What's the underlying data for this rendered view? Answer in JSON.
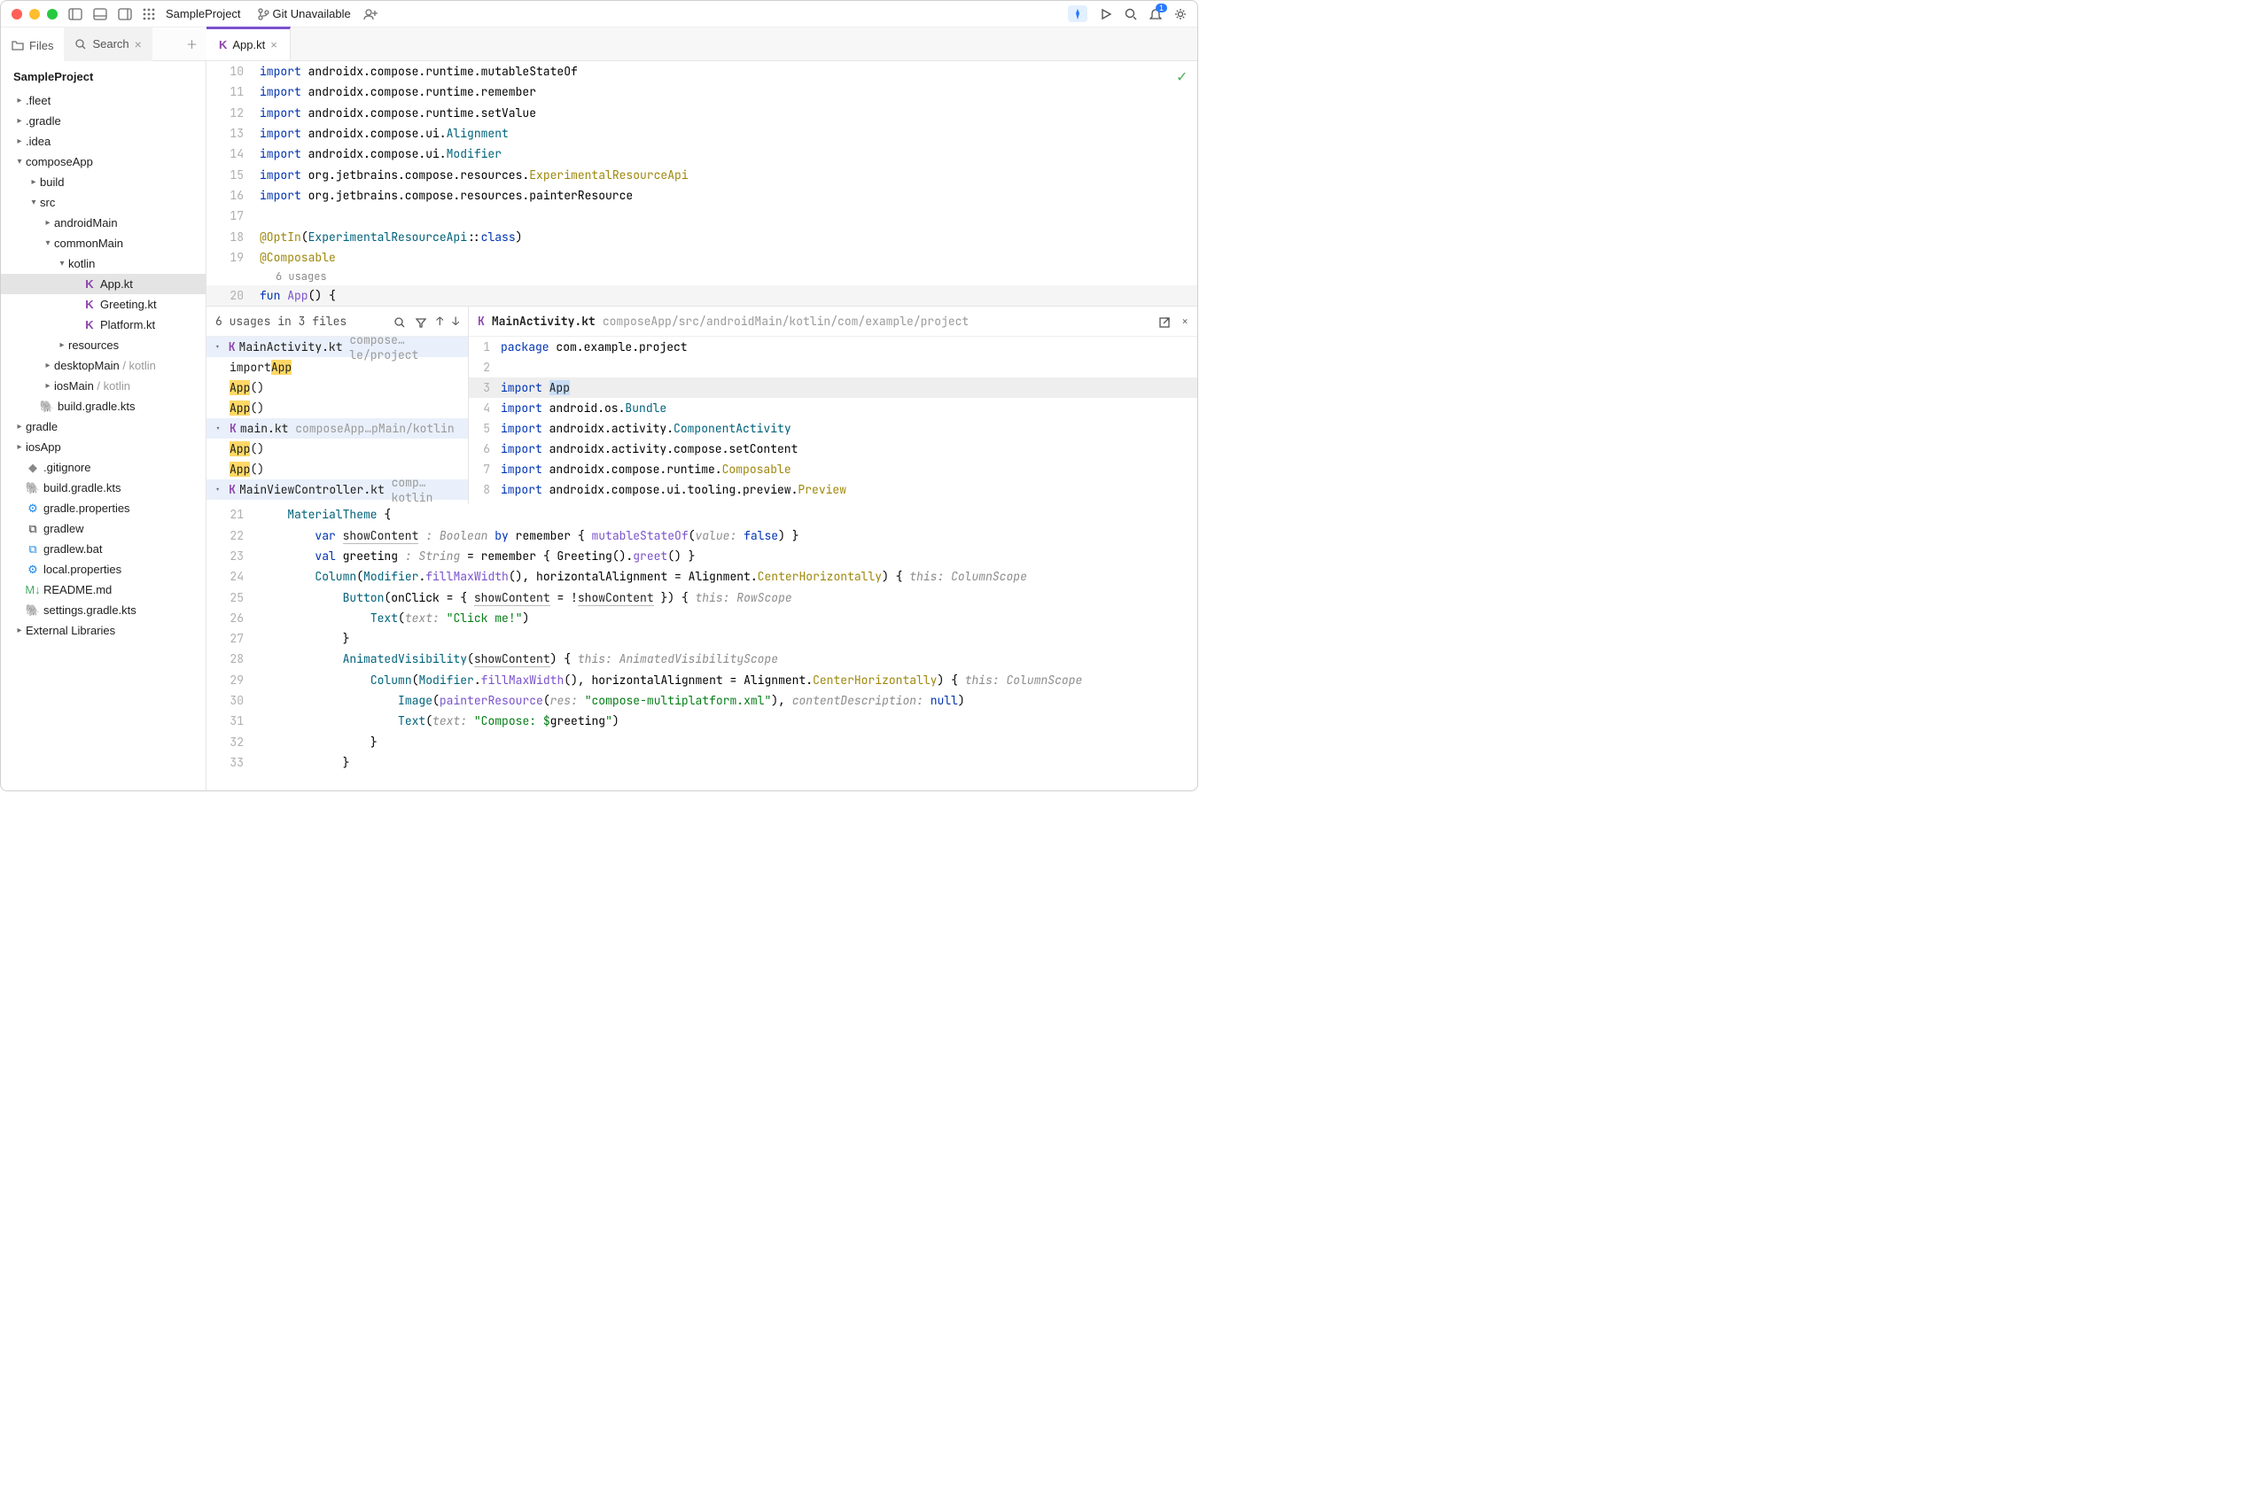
{
  "titlebar": {
    "project": "SampleProject",
    "git": "Git Unavailable",
    "notif_count": "1"
  },
  "side_tabs": {
    "files": "Files",
    "search": "Search"
  },
  "editor_tab": {
    "name": "App.kt"
  },
  "project": {
    "name": "SampleProject",
    "tree": [
      {
        "d": 0,
        "exp": "▸",
        "label": ".fleet"
      },
      {
        "d": 0,
        "exp": "▸",
        "label": ".gradle"
      },
      {
        "d": 0,
        "exp": "▸",
        "label": ".idea"
      },
      {
        "d": 0,
        "exp": "▾",
        "label": "composeApp"
      },
      {
        "d": 1,
        "exp": "▸",
        "label": "build"
      },
      {
        "d": 1,
        "exp": "▾",
        "label": "src"
      },
      {
        "d": 2,
        "exp": "▸",
        "label": "androidMain"
      },
      {
        "d": 2,
        "exp": "▾",
        "label": "commonMain"
      },
      {
        "d": 3,
        "exp": "▾",
        "label": "kotlin"
      },
      {
        "d": 4,
        "icon": "k",
        "label": "App.kt",
        "sel": true
      },
      {
        "d": 4,
        "icon": "k",
        "label": "Greeting.kt"
      },
      {
        "d": 4,
        "icon": "k",
        "label": "Platform.kt"
      },
      {
        "d": 3,
        "exp": "▸",
        "label": "resources"
      },
      {
        "d": 2,
        "exp": "▸",
        "label": "desktopMain",
        "suffix": "/ kotlin"
      },
      {
        "d": 2,
        "exp": "▸",
        "label": "iosMain",
        "suffix": "/ kotlin"
      },
      {
        "d": 1,
        "icon": "gradle",
        "label": "build.gradle.kts"
      },
      {
        "d": 0,
        "exp": "▸",
        "label": "gradle"
      },
      {
        "d": 0,
        "exp": "▸",
        "label": "iosApp"
      },
      {
        "d": 0,
        "icon": "git",
        "label": ".gitignore"
      },
      {
        "d": 0,
        "icon": "gradle",
        "label": "build.gradle.kts"
      },
      {
        "d": 0,
        "icon": "gear",
        "label": "gradle.properties"
      },
      {
        "d": 0,
        "icon": "sh",
        "label": "gradlew"
      },
      {
        "d": 0,
        "icon": "bat",
        "label": "gradlew.bat"
      },
      {
        "d": 0,
        "icon": "gear",
        "label": "local.properties"
      },
      {
        "d": 0,
        "icon": "md",
        "label": "README.md"
      },
      {
        "d": 0,
        "icon": "gradle",
        "label": "settings.gradle.kts"
      },
      {
        "d": 0,
        "exp": "▸",
        "label": "External Libraries"
      }
    ]
  },
  "editor_top": {
    "lines": [
      {
        "n": 10,
        "tokens": [
          [
            "kw",
            "import "
          ],
          [
            "id",
            "androidx.compose.runtime.mutableStateOf"
          ]
        ]
      },
      {
        "n": 11,
        "tokens": [
          [
            "kw",
            "import "
          ],
          [
            "id",
            "androidx.compose.runtime.remember"
          ]
        ]
      },
      {
        "n": 12,
        "tokens": [
          [
            "kw",
            "import "
          ],
          [
            "id",
            "androidx.compose.runtime.setValue"
          ]
        ]
      },
      {
        "n": 13,
        "tokens": [
          [
            "kw",
            "import "
          ],
          [
            "id",
            "androidx.compose.ui."
          ],
          [
            "type",
            "Alignment"
          ]
        ]
      },
      {
        "n": 14,
        "tokens": [
          [
            "kw",
            "import "
          ],
          [
            "id",
            "androidx.compose.ui."
          ],
          [
            "type",
            "Modifier"
          ]
        ]
      },
      {
        "n": 15,
        "tokens": [
          [
            "kw",
            "import "
          ],
          [
            "id",
            "org.jetbrains.compose.resources."
          ],
          [
            "ann",
            "ExperimentalResourceApi"
          ]
        ]
      },
      {
        "n": 16,
        "tokens": [
          [
            "kw",
            "import "
          ],
          [
            "id",
            "org.jetbrains.compose.resources.painterResource"
          ]
        ]
      },
      {
        "n": 17,
        "tokens": []
      },
      {
        "n": 18,
        "tokens": [
          [
            "ann",
            "@OptIn"
          ],
          [
            "id",
            "("
          ],
          [
            "type",
            "ExperimentalResourceApi"
          ],
          [
            "id",
            "::"
          ],
          [
            "kw",
            "class"
          ],
          [
            "id",
            ")"
          ]
        ]
      },
      {
        "n": 19,
        "tokens": [
          [
            "ann",
            "@Composable"
          ]
        ]
      }
    ],
    "usages_inline": "6 usages",
    "fun_line": {
      "n": 20,
      "tokens": [
        [
          "kw",
          "fun "
        ],
        [
          "fn",
          "App"
        ],
        [
          "id",
          "() {"
        ]
      ]
    }
  },
  "usages": {
    "header": "6 usages in 3 files",
    "groups": [
      {
        "file": "MainActivity.kt",
        "path": "compose…le/project",
        "items": [
          {
            "pre": "import ",
            "hl": "App",
            "post": ""
          },
          {
            "pre": "",
            "hl": "App",
            "post": "()"
          },
          {
            "pre": "",
            "hl": "App",
            "post": "()"
          }
        ]
      },
      {
        "file": "main.kt",
        "path": "composeApp…pMain/kotlin",
        "items": [
          {
            "pre": "",
            "hl": "App",
            "post": "()"
          },
          {
            "pre": "",
            "hl": "App",
            "post": "()"
          }
        ]
      },
      {
        "file": "MainViewController.kt",
        "path": "comp…kotlin",
        "items": []
      }
    ]
  },
  "preview": {
    "file": "MainActivity.kt",
    "path": "composeApp/src/androidMain/kotlin/com/example/project",
    "lines": [
      {
        "n": 1,
        "tokens": [
          [
            "kw",
            "package "
          ],
          [
            "id",
            "com.example.project"
          ]
        ]
      },
      {
        "n": 2,
        "tokens": []
      },
      {
        "n": 3,
        "hl": true,
        "tokens": [
          [
            "kw",
            "import "
          ],
          [
            "sel",
            "App"
          ]
        ]
      },
      {
        "n": 4,
        "tokens": [
          [
            "kw",
            "import "
          ],
          [
            "id",
            "android.os."
          ],
          [
            "type",
            "Bundle"
          ]
        ]
      },
      {
        "n": 5,
        "tokens": [
          [
            "kw",
            "import "
          ],
          [
            "id",
            "androidx.activity."
          ],
          [
            "type",
            "ComponentActivity"
          ]
        ]
      },
      {
        "n": 6,
        "tokens": [
          [
            "kw",
            "import "
          ],
          [
            "id",
            "androidx.activity.compose.setContent"
          ]
        ]
      },
      {
        "n": 7,
        "tokens": [
          [
            "kw",
            "import "
          ],
          [
            "id",
            "androidx.compose.runtime."
          ],
          [
            "ann",
            "Composable"
          ]
        ]
      },
      {
        "n": 8,
        "tokens": [
          [
            "kw",
            "import "
          ],
          [
            "id",
            "androidx.compose.ui.tooling.preview."
          ],
          [
            "ann",
            "Preview"
          ]
        ]
      }
    ]
  },
  "editor_bottom": {
    "lines": [
      {
        "n": 21,
        "ind": 1,
        "tokens": [
          [
            "type",
            "MaterialTheme"
          ],
          [
            "id",
            " {"
          ]
        ]
      },
      {
        "n": 22,
        "ind": 2,
        "tokens": [
          [
            "kw",
            "var "
          ],
          [
            "underl",
            "showContent"
          ],
          [
            "param",
            " : Boolean "
          ],
          [
            "kw",
            "by"
          ],
          [
            "id",
            " remember { "
          ],
          [
            "fn",
            "mutableStateOf"
          ],
          [
            "id",
            "("
          ],
          [
            "param",
            "value: "
          ],
          [
            "kw",
            "false"
          ],
          [
            "id",
            ") }"
          ]
        ]
      },
      {
        "n": 23,
        "ind": 2,
        "tokens": [
          [
            "kw",
            "val "
          ],
          [
            "id",
            "greeting"
          ],
          [
            "param",
            " : String "
          ],
          [
            "id",
            "= remember { Greeting()."
          ],
          [
            "fn",
            "greet"
          ],
          [
            "id",
            "() }"
          ]
        ]
      },
      {
        "n": 24,
        "ind": 2,
        "tokens": [
          [
            "type",
            "Column"
          ],
          [
            "id",
            "("
          ],
          [
            "type",
            "Modifier"
          ],
          [
            "id",
            "."
          ],
          [
            "fn",
            "fillMaxWidth"
          ],
          [
            "id",
            "(), horizontalAlignment = Alignment."
          ],
          [
            "ann",
            "CenterHorizontally"
          ],
          [
            "id",
            ") { "
          ],
          [
            "param",
            "this: ColumnScope"
          ]
        ]
      },
      {
        "n": 25,
        "ind": 3,
        "tokens": [
          [
            "type",
            "Button"
          ],
          [
            "id",
            "(onClick = { "
          ],
          [
            "underl",
            "showContent"
          ],
          [
            "id",
            " = !"
          ],
          [
            "underl",
            "showContent"
          ],
          [
            "id",
            " }) { "
          ],
          [
            "param",
            "this: RowScope"
          ]
        ]
      },
      {
        "n": 26,
        "ind": 4,
        "tokens": [
          [
            "type",
            "Text"
          ],
          [
            "id",
            "("
          ],
          [
            "param",
            "text: "
          ],
          [
            "str",
            "\"Click me!\""
          ],
          [
            "id",
            ")"
          ]
        ]
      },
      {
        "n": 27,
        "ind": 3,
        "tokens": [
          [
            "id",
            "}"
          ]
        ]
      },
      {
        "n": 28,
        "ind": 3,
        "tokens": [
          [
            "type",
            "AnimatedVisibility"
          ],
          [
            "id",
            "("
          ],
          [
            "underl",
            "showContent"
          ],
          [
            "id",
            ") { "
          ],
          [
            "param",
            "this: AnimatedVisibilityScope"
          ]
        ]
      },
      {
        "n": 29,
        "ind": 4,
        "tokens": [
          [
            "type",
            "Column"
          ],
          [
            "id",
            "("
          ],
          [
            "type",
            "Modifier"
          ],
          [
            "id",
            "."
          ],
          [
            "fn",
            "fillMaxWidth"
          ],
          [
            "id",
            "(), horizontalAlignment = Alignment."
          ],
          [
            "ann",
            "CenterHorizontally"
          ],
          [
            "id",
            ") { "
          ],
          [
            "param",
            "this: ColumnScope"
          ]
        ]
      },
      {
        "n": 30,
        "ind": 5,
        "tokens": [
          [
            "type",
            "Image"
          ],
          [
            "id",
            "("
          ],
          [
            "fn",
            "painterResource"
          ],
          [
            "id",
            "("
          ],
          [
            "param",
            "res: "
          ],
          [
            "str",
            "\"compose-multiplatform.xml\""
          ],
          [
            "id",
            "), "
          ],
          [
            "param",
            "contentDescription: "
          ],
          [
            "kw",
            "null"
          ],
          [
            "id",
            ")"
          ]
        ]
      },
      {
        "n": 31,
        "ind": 5,
        "tokens": [
          [
            "type",
            "Text"
          ],
          [
            "id",
            "("
          ],
          [
            "param",
            "text: "
          ],
          [
            "str",
            "\"Compose: $"
          ],
          [
            "id",
            "greeting"
          ],
          [
            "str",
            "\""
          ],
          [
            "id",
            ")"
          ]
        ]
      },
      {
        "n": 32,
        "ind": 4,
        "tokens": [
          [
            "id",
            "}"
          ]
        ]
      },
      {
        "n": 33,
        "ind": 3,
        "tokens": [
          [
            "id",
            "}"
          ]
        ]
      }
    ]
  }
}
